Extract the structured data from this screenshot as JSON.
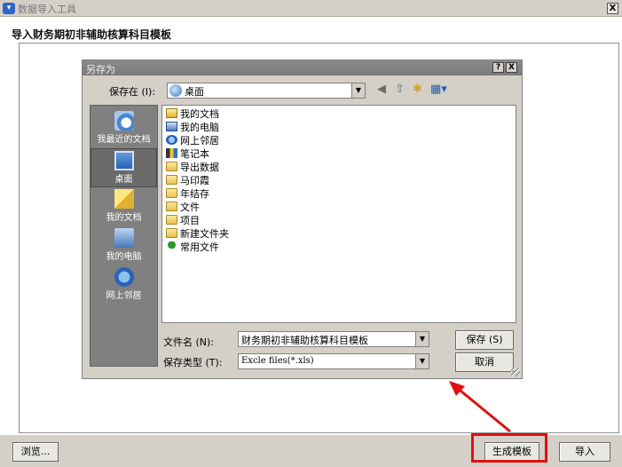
{
  "outer_window": {
    "title": "数据导入工具",
    "close_label": "X",
    "header_title": "导入财务期初非辅助核算科目模板"
  },
  "footer": {
    "browse_label": "浏览...",
    "generate_label": "生成模板",
    "import_label": "导入"
  },
  "dialog": {
    "title": "另存为",
    "help_label": "?",
    "close_label": "X",
    "save_in_label": "保存在 (I):",
    "save_in_value": "桌面",
    "places": [
      {
        "label": "我最近的文档",
        "icon": "recent-documents-icon"
      },
      {
        "label": "桌面",
        "icon": "desktop-icon"
      },
      {
        "label": "我的文档",
        "icon": "my-documents-icon"
      },
      {
        "label": "我的电脑",
        "icon": "my-computer-icon"
      },
      {
        "label": "网上邻居",
        "icon": "network-places-icon"
      }
    ],
    "files": [
      {
        "name": "我的文档",
        "icon": "my-documents-icon"
      },
      {
        "name": "我的电脑",
        "icon": "my-computer-icon"
      },
      {
        "name": "网上邻居",
        "icon": "network-places-icon"
      },
      {
        "name": "笔记本",
        "icon": "notebook-icon"
      },
      {
        "name": "导出数据",
        "icon": "folder-icon"
      },
      {
        "name": "马印霞",
        "icon": "folder-icon"
      },
      {
        "name": "年结存",
        "icon": "folder-icon"
      },
      {
        "name": "文件",
        "icon": "folder-icon"
      },
      {
        "name": "项目",
        "icon": "folder-icon"
      },
      {
        "name": "新建文件夹",
        "icon": "folder-icon"
      },
      {
        "name": "常用文件",
        "icon": "shared-tree-icon"
      }
    ],
    "filename_label": "文件名 (N):",
    "filename_value": "财务期初非辅助核算科目模板",
    "savetype_label": "保存类型 (T):",
    "savetype_value": "Excle files(*.xls)",
    "save_label": "保存 (S)",
    "cancel_label": "取消"
  },
  "colors": {
    "annotation": "#e01010",
    "dialog_face": "#d4d0c8",
    "places_bar": "#808080"
  }
}
